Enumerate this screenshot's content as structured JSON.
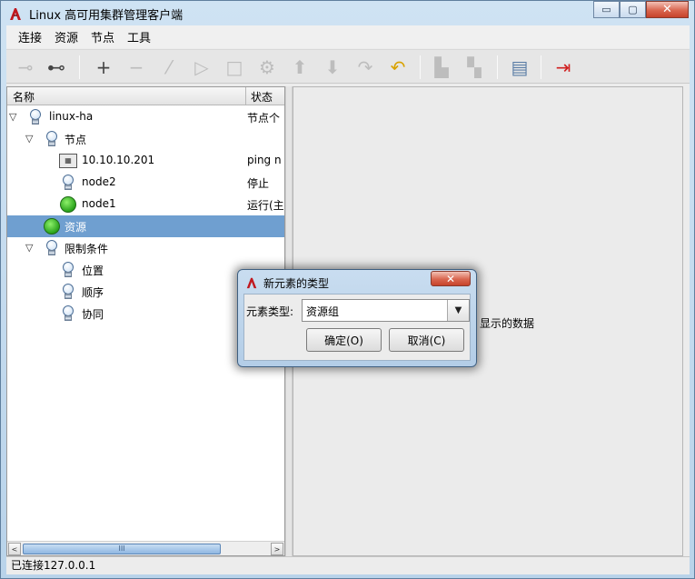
{
  "window": {
    "title": "Linux 高可用集群管理客户端",
    "min_glyph": "▭",
    "max_glyph": "▢",
    "close_glyph": "✕"
  },
  "menu": [
    "连接",
    "资源",
    "节点",
    "工具"
  ],
  "tree": {
    "col_name": "名称",
    "col_status": "状态",
    "rows": [
      {
        "label": "linux-ha",
        "status": "节点个",
        "icon": "bulb-icon"
      },
      {
        "label": "节点",
        "status": "",
        "icon": "bulb-icon"
      },
      {
        "label": "10.10.10.201",
        "status": "ping n",
        "icon": "network-icon"
      },
      {
        "label": "node2",
        "status": "停止",
        "icon": "bulb-icon"
      },
      {
        "label": "node1",
        "status": "运行(主",
        "icon": "green-status-icon"
      },
      {
        "label": "资源",
        "status": "",
        "icon": "green-status-icon",
        "selected": true
      },
      {
        "label": "限制条件",
        "status": "",
        "icon": "bulb-icon"
      },
      {
        "label": "位置",
        "status": "",
        "icon": "bulb-icon"
      },
      {
        "label": "顺序",
        "status": "",
        "icon": "bulb-icon"
      },
      {
        "label": "协同",
        "status": "",
        "icon": "bulb-icon"
      }
    ],
    "expand_glyph": "▽",
    "scroll_left": "<",
    "scroll_right": ">",
    "scroll_grip": "III"
  },
  "right_panel": {
    "text": "显示的数据"
  },
  "statusbar": {
    "text": "已连接127.0.0.1"
  },
  "dialog": {
    "title": "新元素的类型",
    "close_glyph": "✕",
    "type_label": "元素类型:",
    "type_value": "资源组",
    "dropdown_glyph": "▼",
    "ok_label": "确定(O)",
    "cancel_label": "取消(C)"
  },
  "toolbar": {
    "icons": [
      "disconnect-icon",
      "connect-icon",
      "add-icon",
      "remove-icon",
      "clean-icon",
      "start-icon",
      "stop-icon",
      "settings-icon",
      "move-up-icon",
      "move-down-icon",
      "redo-icon",
      "undo-icon",
      "standby-icon",
      "online-icon",
      "view-icon",
      "exit-icon"
    ],
    "glyphs": {
      "disconnect": "⊸",
      "connect": "⊷",
      "add": "+",
      "remove": "−",
      "clean": "⁄",
      "start": "▷",
      "stop": "□",
      "settings": "⚙",
      "up": "⬆",
      "down": "⬇",
      "redo": "↷",
      "undo": "↶",
      "standby": "▙",
      "online": "▚",
      "view": "▤",
      "exit": "⇥"
    }
  },
  "colors": {
    "selection": "#6f9fd0",
    "title_bar": "#cfe3f3",
    "close_button": "#c7432b"
  }
}
